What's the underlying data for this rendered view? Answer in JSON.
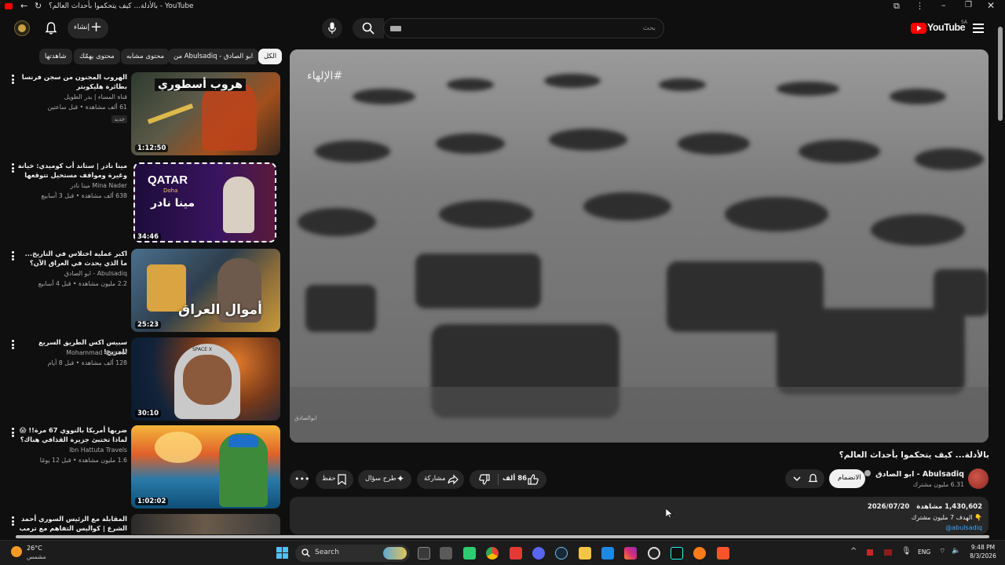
{
  "browser": {
    "tab_title": "بالأدلة... كيف يتحكموا بأحداث العالم؟ - YouTube"
  },
  "header": {
    "logo_text": "YouTube",
    "region": "SA",
    "search_placeholder": "بحث",
    "create_label": "إنشاء"
  },
  "chips": [
    "الكل",
    "من Abulsadiq - ابو الصادق",
    "محتوى مشابه",
    "محتوى يهمّك",
    "شاهدتها"
  ],
  "recommendations": [
    {
      "title": "الهروب المجنون من سجن فرنسا بطائرة هليكوبتر",
      "channel": "قناة المساء | بدر الطويل",
      "meta": "61 ألف مشاهدة • قبل ساعتين",
      "badge": "جديد",
      "duration": "1:12:50",
      "thumb_text": "هروب أسطوري"
    },
    {
      "title": "مينا نادر | ستاند أب كوميدي: خيانة وغيرة ومواقف مستحيل تتوقعها",
      "channel": "Mina Nader مينا نادر",
      "meta": "638 ألف مشاهدة • قبل 3 أسابيع",
      "badge": "",
      "duration": "34:46",
      "thumb_text": "QATAR",
      "thumb_sub": "Doha",
      "thumb_text2": "مينا نادر"
    },
    {
      "title": "اكبر عملية اختلاس في التاريخ... ما الذي يحدث في العراق الآن؟",
      "channel": "Abulsadiq - ابو الصادق",
      "meta": "2.2 مليون مشاهدة • قبل 4 أسابيع",
      "badge": "",
      "duration": "25:23",
      "thumb_text": "أموال العراق"
    },
    {
      "title": "سبيس اكس الطريق السريع للمريخ!",
      "channel": "Mohammad Youssef",
      "meta": "128 ألف مشاهدة • قبل 8 أيام",
      "badge": "",
      "duration": "30:10",
      "thumb_text": "SPACE X"
    },
    {
      "title": "ضربها أمريكا بالنووي 67 مرة!! 😱 لماذا تختبئ جزيرة القذافي هناك؟",
      "channel": "Ibn Hattuta Travels",
      "meta": "1.6 مليون مشاهدة • قبل 12 يومًا",
      "badge": "",
      "duration": "1:02:02",
      "thumb_text": ""
    },
    {
      "title": "المقابلة مع الرئيس السوري أحمد الشرع | كواليس التفاهم مع ترمب ومصير الفراغ...",
      "channel": "",
      "meta": "",
      "badge": "",
      "duration": "",
      "thumb_text": ""
    }
  ],
  "player": {
    "hashtag": "#الإلهاء",
    "watermark": "ابوالصادق"
  },
  "video": {
    "title": "بالأدلة... كيف يتحكموا بأحداث العالم؟",
    "channel": "Abulsadiq - ابو الصادق",
    "subscribers": "6.31 مليون مشترك",
    "join_label": "الانضمام",
    "likes": "86 ألف",
    "share_label": "مشاركة",
    "ask_label": "طرح سؤال",
    "save_label": "حفظ",
    "views": "1,430,602 مشاهدة",
    "date": "2026/07/20",
    "desc_line1": "الهدف 7 مليون مشترك",
    "desc_line2": "@abulsadiq"
  },
  "taskbar": {
    "weather_temp": "26°C",
    "weather_desc": "مشمس",
    "search_label": "Search",
    "lang": "ENG",
    "time": "9:48 PM",
    "date": "8/3/2026"
  }
}
